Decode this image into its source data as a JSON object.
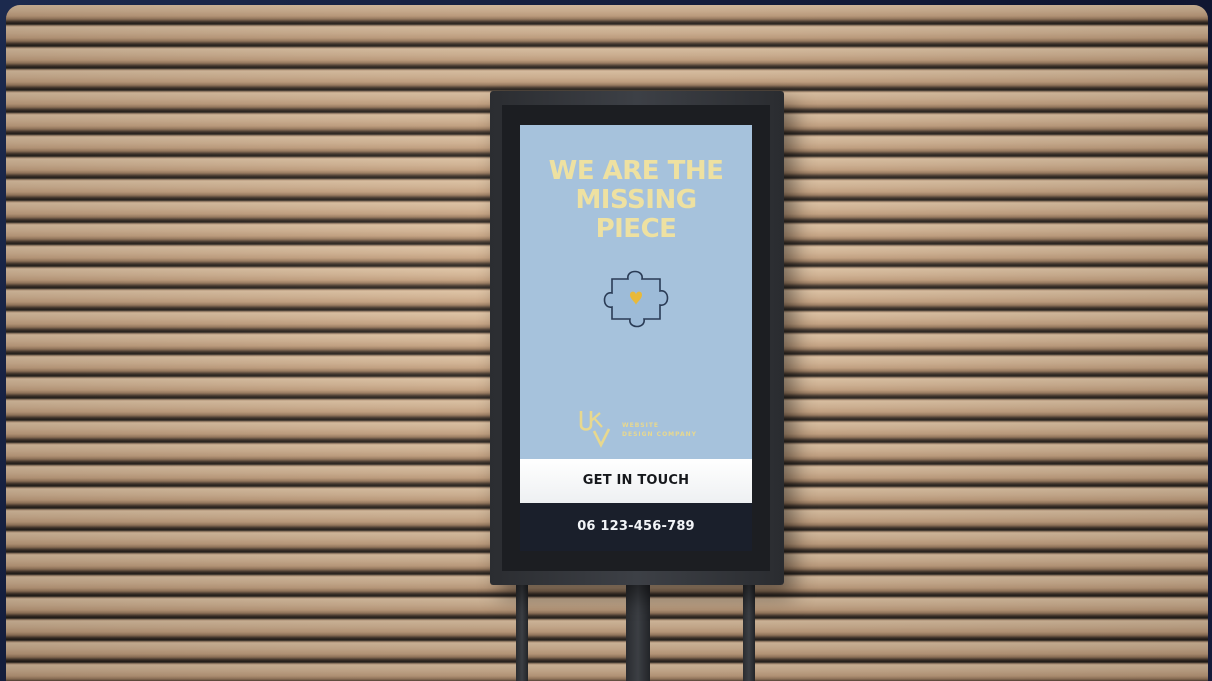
{
  "sign": {
    "headline": [
      "WE ARE THE",
      "MISSING",
      "PIECE"
    ],
    "logo_mark": "UKV",
    "logo_tagline": [
      "WEBSITE",
      "DESIGN COMPANY"
    ],
    "cta_label": "GET IN TOUCH",
    "phone": "06 123-456-789"
  },
  "icons": {
    "puzzle": "puzzle-piece-with-heart-icon",
    "logo": "company-monogram-logo"
  },
  "colors": {
    "screen_bg": "#a6c2dc",
    "headline": "#eee1a1",
    "heart": "#e8b93a",
    "cta_bg": "#ffffff",
    "phone_bg": "#1a1f2b",
    "wall": "#d7b796",
    "kiosk_frame": "#2b2d31"
  }
}
